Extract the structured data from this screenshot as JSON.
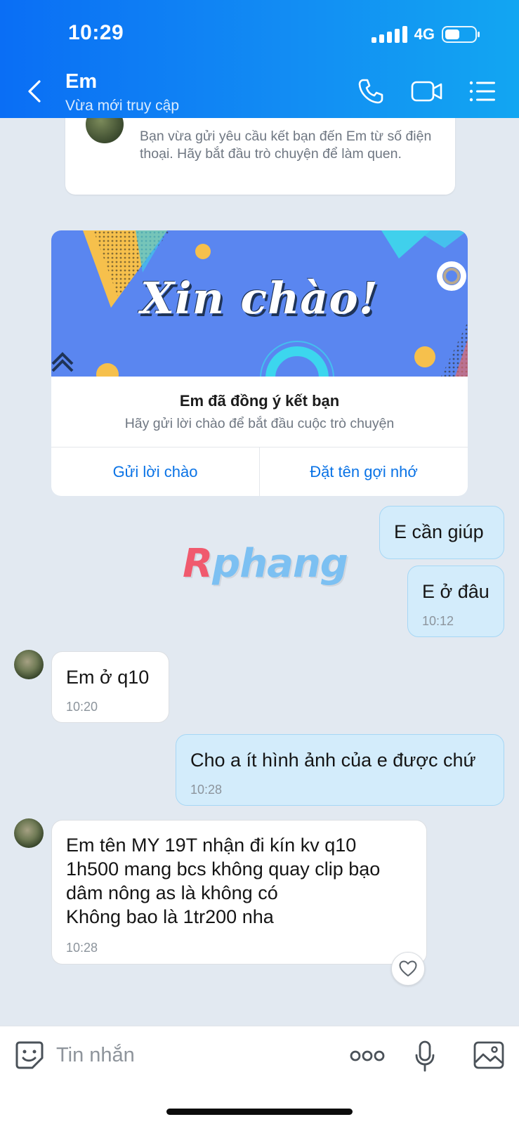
{
  "status_bar": {
    "time": "10:29",
    "network": "4G"
  },
  "header": {
    "title": "Em",
    "subtitle": "Vừa mới truy cập"
  },
  "friend_request_notice": "Bạn vừa gửi yêu cầu kết bạn đến Em từ số điện thoại. Hãy bắt đầu trò chuyện để làm quen.",
  "greeting_card": {
    "banner_text": "Xin chào!",
    "title": "Em đã đồng ý kết bạn",
    "subtitle": "Hãy gửi lời chào để bắt đầu cuộc trò chuyện",
    "actions": [
      "Gửi lời chào",
      "Đặt tên gợi nhớ"
    ]
  },
  "watermark": {
    "first": "R",
    "rest": "phang"
  },
  "messages": [
    {
      "direction": "out",
      "lines": [
        "E cần giúp"
      ],
      "time": ""
    },
    {
      "direction": "out",
      "lines": [
        "E ở đâu"
      ],
      "time": "10:12"
    },
    {
      "direction": "in",
      "lines": [
        "Em ở q10"
      ],
      "time": "10:20"
    },
    {
      "direction": "out",
      "lines": [
        "Cho a ít hình ảnh của e được chứ"
      ],
      "time": "10:28"
    },
    {
      "direction": "in",
      "lines": [
        "Em tên MY 19T nhận đi kín kv q10",
        "1h500 mang bcs không quay clip bạo",
        "dâm nông as là không có",
        "Không bao là 1tr200 nha"
      ],
      "time": "10:28"
    }
  ],
  "composer": {
    "placeholder": "Tin nhắn"
  },
  "colors": {
    "header_start": "#0a6ef5",
    "header_end": "#12a6f2",
    "outgoing_bubble": "#d3ecfb",
    "link": "#0a73e6",
    "chat_background": "#e2e9f1"
  },
  "icons": [
    "back-chevron-icon",
    "phone-icon",
    "video-camera-icon",
    "list-menu-icon",
    "heart-icon",
    "sticker-icon",
    "more-dots-icon",
    "microphone-icon",
    "image-icon"
  ]
}
